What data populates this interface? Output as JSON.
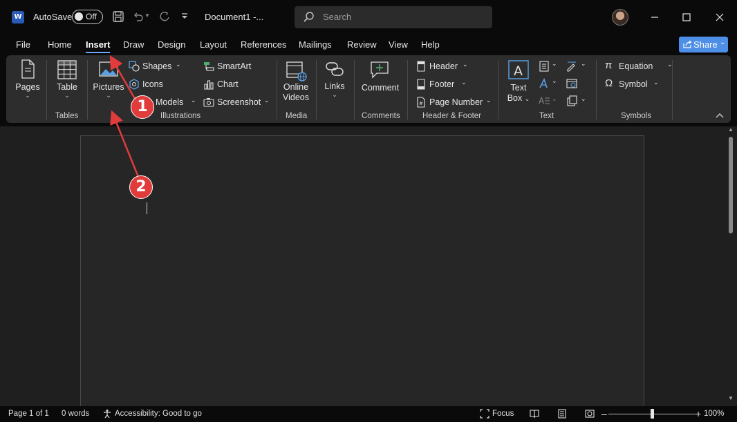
{
  "titlebar": {
    "app_logo_letter": "W",
    "autosave_label": "AutoSave",
    "autosave_state": "Off",
    "document_title": "Document1  -...",
    "search_placeholder": "Search"
  },
  "menu": {
    "tabs": [
      "File",
      "Home",
      "Insert",
      "Draw",
      "Design",
      "Layout",
      "References",
      "Mailings",
      "Review",
      "View",
      "Help"
    ],
    "active_tab": "Insert",
    "share_label": "Share"
  },
  "ribbon": {
    "pages": {
      "label": "Pages"
    },
    "tables": {
      "table_label": "Table",
      "group_label": "Tables"
    },
    "illustrations": {
      "pictures_label": "Pictures",
      "shapes_label": "Shapes",
      "icons_label": "Icons",
      "models_label": "Models",
      "smartart_label": "SmartArt",
      "chart_label": "Chart",
      "screenshot_label": "Screenshot",
      "group_label": "Illustrations"
    },
    "media": {
      "online_label_1": "Online",
      "online_label_2": "Videos",
      "group_label": "Media"
    },
    "links": {
      "label": "Links"
    },
    "comments": {
      "comment_label": "Comment",
      "group_label": "Comments"
    },
    "header_footer": {
      "header_label": "Header",
      "footer_label": "Footer",
      "page_number_label": "Page Number",
      "group_label": "Header & Footer"
    },
    "text": {
      "textbox_label_1": "Text",
      "textbox_label_2": "Box",
      "group_label": "Text"
    },
    "symbols": {
      "equation_label": "Equation",
      "symbol_label": "Symbol",
      "group_label": "Symbols"
    }
  },
  "annotations": {
    "badge_1": "1",
    "badge_2": "2",
    "color": "#e23b3b"
  },
  "statusbar": {
    "page_info": "Page 1 of 1",
    "word_count": "0 words",
    "accessibility": "Accessibility: Good to go",
    "focus_label": "Focus",
    "zoom_level": "100%",
    "zoom_fraction": 0.5
  }
}
